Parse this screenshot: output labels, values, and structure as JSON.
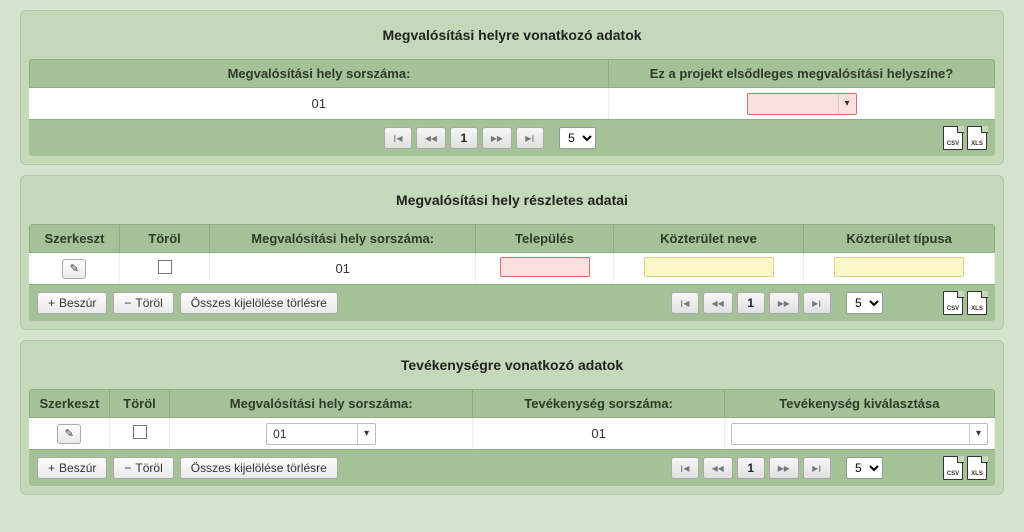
{
  "panel1": {
    "title": "Megvalósítási helyre vonatkozó adatok",
    "headers": {
      "col1": "Megvalósítási hely sorszáma:",
      "col2": "Ez a projekt elsődleges megvalósítási helyszíne?"
    },
    "row": {
      "sorszam": "01"
    }
  },
  "panel2": {
    "title": "Megvalósítási hely részletes adatai",
    "headers": {
      "edit": "Szerkeszt",
      "del": "Töröl",
      "sorszam": "Megvalósítási hely sorszáma:",
      "telepules": "Település",
      "kozter_neve": "Közterület neve",
      "kozter_tipusa": "Közterület típusa"
    },
    "row": {
      "sorszam": "01"
    }
  },
  "panel3": {
    "title": "Tevékenységre vonatkozó adatok",
    "headers": {
      "edit": "Szerkeszt",
      "del": "Töröl",
      "meg_sorszam": "Megvalósítási hely sorszáma:",
      "tev_sorszam": "Tevékenység sorszáma:",
      "tev_kiv": "Tevékenység kiválasztása"
    },
    "row": {
      "meg_sorszam": "01",
      "tev_sorszam": "01"
    }
  },
  "common": {
    "insert": "Beszúr",
    "delete": "Töröl",
    "clear_all": "Összes kijelölése törlésre",
    "page": "1",
    "page_size": "5",
    "first": "⏮",
    "prev": "◀◀",
    "next": "▶▶",
    "last": "⏭",
    "csv": "CSV",
    "xls": "XLS",
    "plus": "+",
    "minus": "−",
    "pencil": "✎",
    "caret": "▾"
  }
}
